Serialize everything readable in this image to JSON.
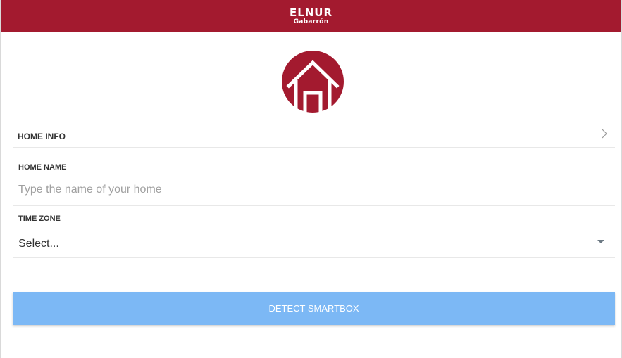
{
  "header": {
    "brand_top": "ELNUR",
    "brand_bottom": "Gabarrón",
    "background_color": "#a31a2f"
  },
  "logo": {
    "icon": "house-icon",
    "color": "#a31a2f"
  },
  "home_info": {
    "label": "HOME INFO",
    "icon": "chevron-right-icon"
  },
  "home_name": {
    "label": "HOME NAME",
    "value": "",
    "placeholder": "Type the name of your home"
  },
  "time_zone": {
    "label": "TIME ZONE",
    "selected": "Select...",
    "icon": "caret-down-icon"
  },
  "actions": {
    "detect_label": "DETECT SMARTBOX",
    "detect_color": "#7cb8f5"
  }
}
